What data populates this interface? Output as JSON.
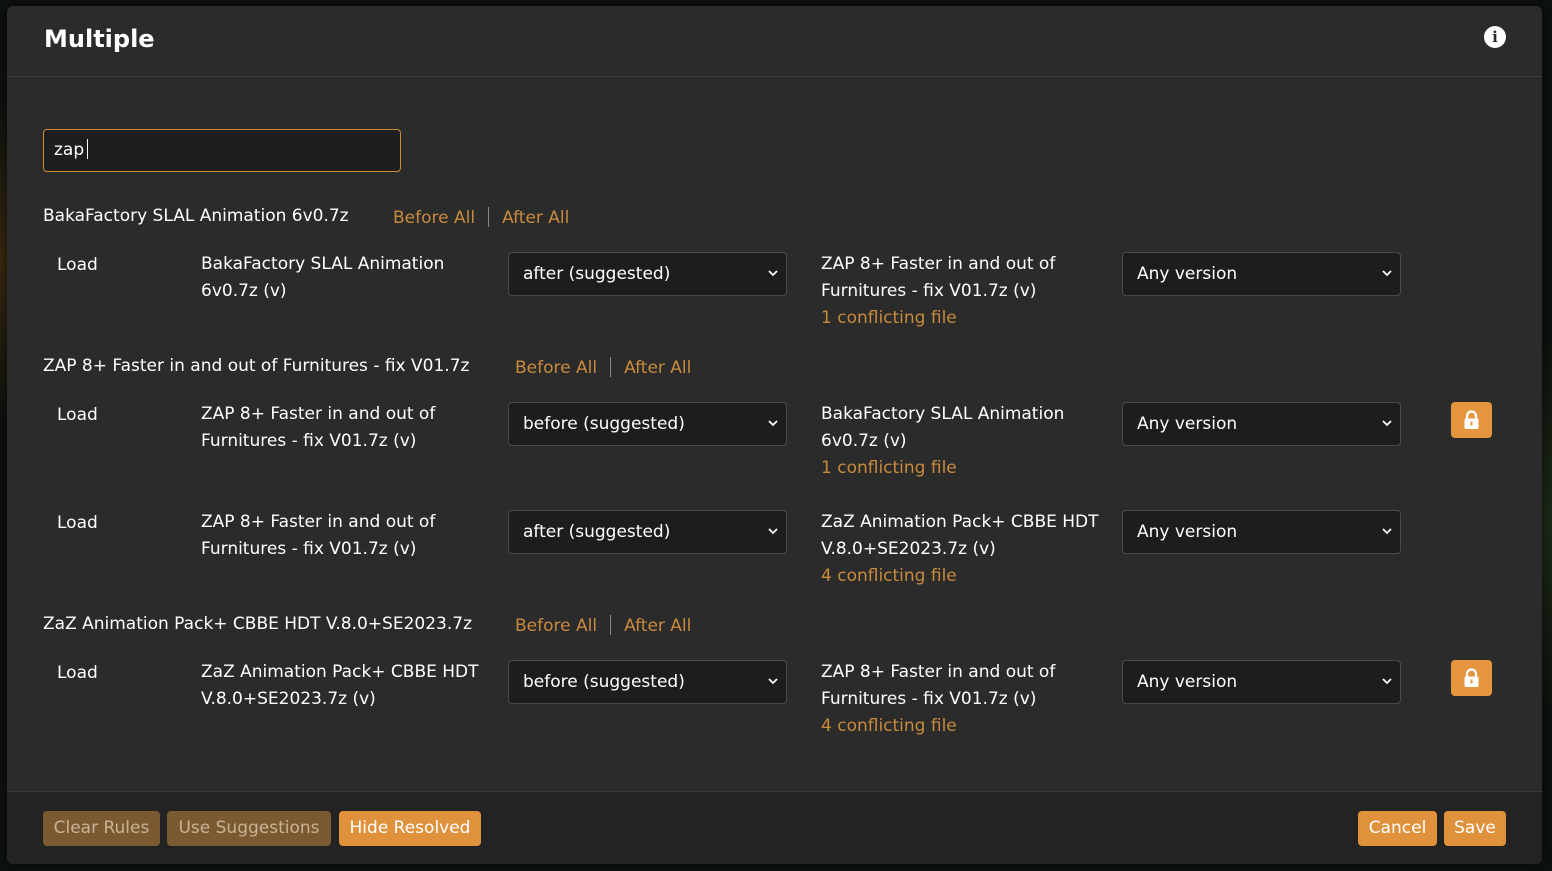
{
  "dialog": {
    "title": "Multiple",
    "info_icon": "info-circle-icon"
  },
  "search": {
    "value": "zap"
  },
  "groups": [
    {
      "title": "BakaFactory SLAL Animation 6v0.7z",
      "before_all": "Before All",
      "after_all": "After All",
      "rules": [
        {
          "load": "Load",
          "mod": "BakaFactory SLAL Animation 6v0.7z (v)",
          "order": "after (suggested)",
          "target": "ZAP 8+ Faster in and out of Furnitures - fix V01.7z (v)",
          "conflicts": "1 conflicting file",
          "version": "Any version",
          "locked": false
        }
      ]
    },
    {
      "title": "ZAP 8+ Faster in and out of Furnitures - fix V01.7z",
      "before_all": "Before All",
      "after_all": "After All",
      "rules": [
        {
          "load": "Load",
          "mod": "ZAP 8+ Faster in and out of Furnitures - fix V01.7z (v)",
          "order": "before (suggested)",
          "target": "BakaFactory SLAL Animation 6v0.7z (v)",
          "conflicts": "1 conflicting file",
          "version": "Any version",
          "locked": true
        },
        {
          "load": "Load",
          "mod": "ZAP 8+ Faster in and out of Furnitures - fix V01.7z (v)",
          "order": "after (suggested)",
          "target": "ZaZ Animation Pack+ CBBE HDT V.8.0+SE2023.7z (v)",
          "conflicts": "4 conflicting file",
          "version": "Any version",
          "locked": false
        }
      ]
    },
    {
      "title": "ZaZ Animation Pack+ CBBE HDT V.8.0+SE2023.7z",
      "before_all": "Before All",
      "after_all": "After All",
      "rules": [
        {
          "load": "Load",
          "mod": "ZaZ Animation Pack+ CBBE HDT V.8.0+SE2023.7z (v)",
          "order": "before (suggested)",
          "target": "ZAP 8+ Faster in and out of Furnitures - fix V01.7z (v)",
          "conflicts": "4 conflicting file",
          "version": "Any version",
          "locked": true
        }
      ]
    }
  ],
  "footer": {
    "clear_rules": "Clear Rules",
    "use_suggestions": "Use Suggestions",
    "hide_resolved": "Hide Resolved",
    "cancel": "Cancel",
    "save": "Save"
  },
  "colors": {
    "accent": "#e0913b",
    "link": "#c98a3c",
    "background": "#2b2b2b"
  },
  "icons": {
    "select_chevron": "chevron-down-icon",
    "lock": "lock-icon"
  }
}
